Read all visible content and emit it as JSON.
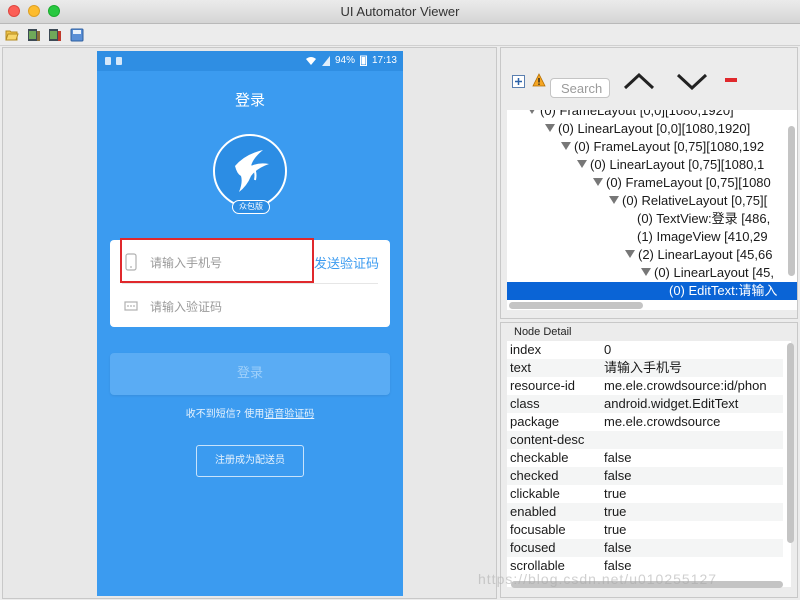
{
  "window": {
    "title": "UI Automator Viewer"
  },
  "toolbar_icons": [
    "folder-open-icon",
    "device-screenshot-icon",
    "device-screenshot-compressed-icon",
    "save-icon"
  ],
  "phone": {
    "status": {
      "battery": "94%",
      "time": "17:13"
    },
    "title": "登录",
    "logo_badge": "众包版",
    "phone_placeholder": "请输入手机号",
    "send_code": "发送验证码",
    "code_placeholder": "请输入验证码",
    "login_button": "登录",
    "sms_hint_prefix": "收不到短信? 使用",
    "sms_hint_link": "语音验证码",
    "register_button": "注册成为配送员"
  },
  "tree": {
    "search_placeholder": "Search",
    "rows": [
      {
        "text": "(0) FrameLayout [0,0][1080,1920]",
        "arrow": true
      },
      {
        "text": "(0) LinearLayout [0,0][1080,1920]",
        "arrow": true
      },
      {
        "text": "(0) FrameLayout [0,75][1080,192",
        "arrow": true
      },
      {
        "text": "(0) LinearLayout [0,75][1080,1",
        "arrow": true
      },
      {
        "text": "(0) FrameLayout [0,75][1080",
        "arrow": true
      },
      {
        "text": "(0) RelativeLayout [0,75][",
        "arrow": true
      },
      {
        "text": "(0) TextView:登录 [486,",
        "arrow": false
      },
      {
        "text": "(1) ImageView [410,29",
        "arrow": false
      },
      {
        "text": "(2) LinearLayout [45,66",
        "arrow": true
      },
      {
        "text": "(0) LinearLayout [45,",
        "arrow": true
      },
      {
        "text": "(0) EditText:请输入",
        "arrow": false
      }
    ]
  },
  "detail": {
    "label": "Node Detail",
    "rows": [
      {
        "key": "index",
        "value": "0"
      },
      {
        "key": "text",
        "value": "请输入手机号"
      },
      {
        "key": "resource-id",
        "value": "me.ele.crowdsource:id/phon"
      },
      {
        "key": "class",
        "value": "android.widget.EditText"
      },
      {
        "key": "package",
        "value": "me.ele.crowdsource"
      },
      {
        "key": "content-desc",
        "value": ""
      },
      {
        "key": "checkable",
        "value": "false"
      },
      {
        "key": "checked",
        "value": "false"
      },
      {
        "key": "clickable",
        "value": "true"
      },
      {
        "key": "enabled",
        "value": "true"
      },
      {
        "key": "focusable",
        "value": "true"
      },
      {
        "key": "focused",
        "value": "false"
      },
      {
        "key": "scrollable",
        "value": "false"
      }
    ]
  },
  "watermark": "https://blog.csdn.net/u010255127"
}
